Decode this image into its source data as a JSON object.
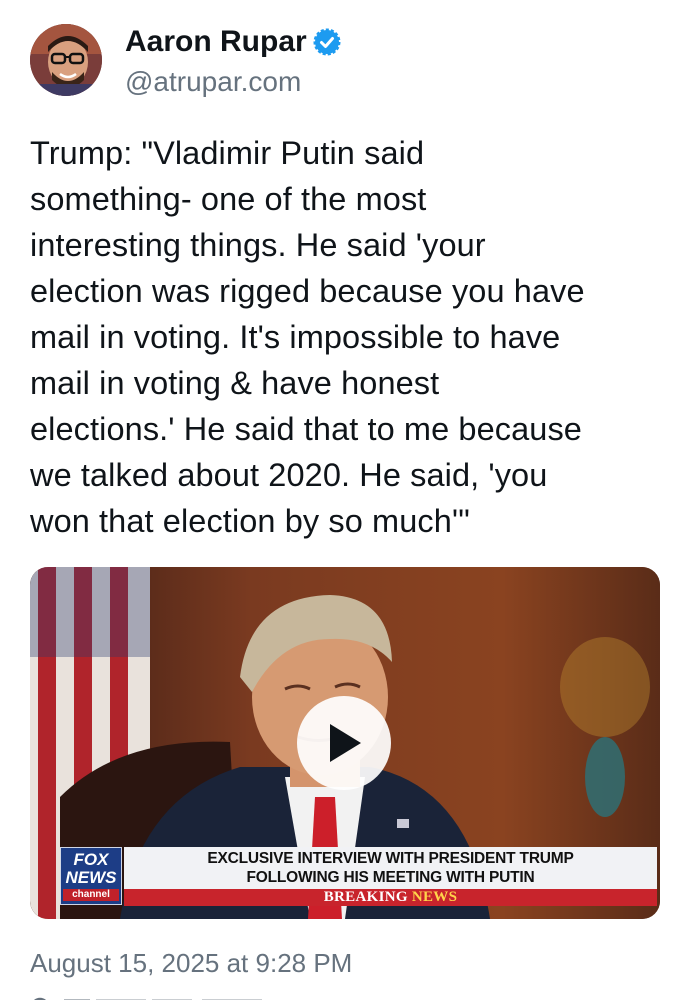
{
  "author": {
    "display_name": "Aaron Rupar",
    "handle": "@atrupar.com",
    "verified_icon": "verified-badge-icon",
    "verified_color": "#1d9bf0"
  },
  "post": {
    "text": "Trump: \"Vladimir Putin said\nsomething- one of the most\ninteresting things. He said 'your\nelection was rigged because you have\nmail in voting. It's impossible to have\nmail in voting & have honest\nelections.' He said that to me because\nwe talked about 2020. He said, 'you\nwon that election by so much'\"",
    "timestamp": "August 15, 2025 at 9:28 PM"
  },
  "video": {
    "play_icon": "play-icon",
    "logo": {
      "line1": "FOX",
      "line2": "NEWS",
      "line3": "channel"
    },
    "chyron": {
      "line1": "EXCLUSIVE INTERVIEW WITH PRESIDENT TRUMP",
      "line2": "FOLLOWING HIS MEETING WITH PUTIN",
      "breaking_word1": "BREAKING",
      "breaking_word2": "NEWS"
    }
  }
}
